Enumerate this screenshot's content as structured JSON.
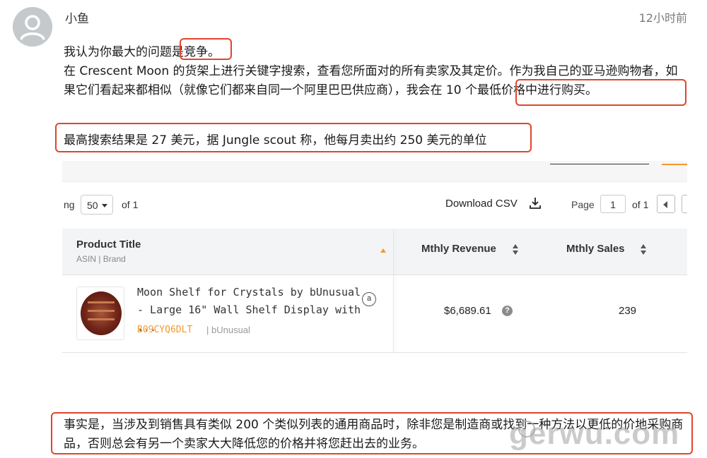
{
  "comment": {
    "user": "小鱼",
    "time": "12小时前",
    "p1": "我认为你最大的问题是竞争。",
    "p2": "在 Crescent Moon 的货架上进行关键字搜索，查看您所面对的所有卖家及其定价。作为我自己的亚马逊购物者，如果它们看起来都相似（就像它们都来自同一个阿里巴巴供应商），我会在 10 个最低价格中进行购买。",
    "p3": "最高搜索结果是 27 美元，据 Jungle scout 称，他每月卖出约 250 美元的单位",
    "p4": "事实是，当涉及到销售具有类似 200 个类似列表的通用商品时，除非您是制造商或找到一种方法以更低的价地采购商品，否则总会有另一个卖家大大降低您的价格并将您赶出去的业务。"
  },
  "screenshot": {
    "pager": {
      "cut_label": "ng",
      "per_page": "50",
      "of_left": "of 1",
      "download_label": "Download CSV",
      "page_label": "Page",
      "page_value": "1",
      "of_right": "of 1"
    },
    "table": {
      "col_title": "Product Title",
      "col_title_sub": "ASIN | Brand",
      "col_revenue": "Mthly Revenue",
      "col_sales": "Mthly Sales",
      "row": {
        "name": "Moon Shelf for Crystals by bUnusual - Large 16\" Wall Shelf Display with ...",
        "asin": "B09CYQ6DLT",
        "brand": "| bUnusual",
        "revenue": "$6,689.61",
        "sales": "239"
      }
    }
  },
  "watermark": "gerwu.com",
  "colors": {
    "highlight": "#e0452d",
    "accent": "#f39a2b"
  },
  "icons": [
    "avatar-icon",
    "download-icon",
    "sort-icon",
    "amazon-icon",
    "help-icon",
    "prev-page-icon"
  ]
}
